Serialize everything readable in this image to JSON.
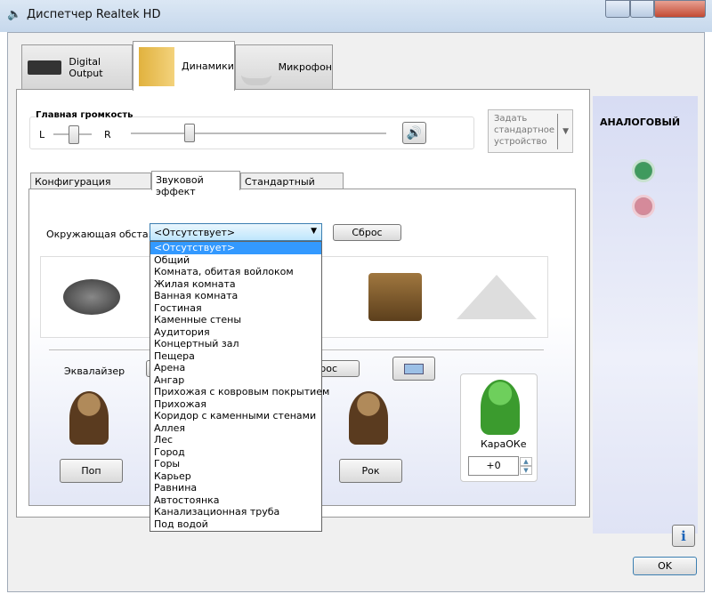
{
  "window": {
    "title": "Диспетчер Realtek HD",
    "icon": "speaker-icon"
  },
  "device_tabs": [
    {
      "label": "Digital Output",
      "icon": "digital-output-icon"
    },
    {
      "label": "Динамики",
      "icon": "speakers-icon",
      "selected": true
    },
    {
      "label": "Микрофон",
      "icon": "microphone-icon"
    }
  ],
  "volume": {
    "title": "Главная громкость",
    "left": "L",
    "right": "R",
    "balance_percent": 50,
    "volume_percent": 23
  },
  "default_device": {
    "label": "Задать стандартное устройство"
  },
  "sub_tabs": [
    {
      "label": "Конфигурация динамиков"
    },
    {
      "label": "Звуковой эффект",
      "selected": true
    },
    {
      "label": "Стандартный формат"
    }
  ],
  "environment": {
    "label": "Окружающая обста...",
    "value": "<Отсутствует>",
    "reset": "Сброс",
    "options": [
      "<Отсутствует>",
      "Общий",
      "Комната, обитая войлоком",
      "Жилая комната",
      "Ванная комната",
      "Гостиная",
      "Каменные стены",
      "Аудитория",
      "Концертный зал",
      "Пещера",
      "Арена",
      "Ангар",
      "Прихожая с ковровым покрытием",
      "Прихожая",
      "Коридор с каменными стенами",
      "Аллея",
      "Лес",
      "Город",
      "Горы",
      "Карьер",
      "Равнина",
      "Автостоянка",
      "Канализационная труба",
      "Под водой"
    ]
  },
  "equalizer": {
    "label": "Эквалайзер",
    "reset": "Сброс",
    "pop": "Поп",
    "rock": "Рок"
  },
  "karaoke": {
    "label": "КараОКе",
    "value": "+0"
  },
  "right_panel": {
    "title": "АНАЛОГОВЫЙ",
    "jack_colors": [
      "#3f9a5e",
      "#d58a9a"
    ]
  },
  "footer": {
    "ok": "OK"
  }
}
